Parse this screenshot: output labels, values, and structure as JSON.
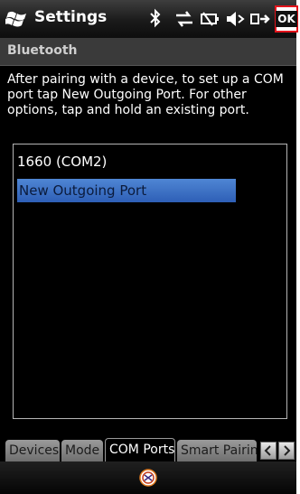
{
  "titlebar": {
    "title": "Settings",
    "ok_label": "OK",
    "icons": [
      "windows-start-icon",
      "bluetooth-icon",
      "sync-icon",
      "battery-icon",
      "volume-icon",
      "network-icon"
    ]
  },
  "section": {
    "title": "Bluetooth"
  },
  "instructions": "After pairing with a device, to set up a COM port tap New Outgoing Port. For other options, tap and hold an existing port.",
  "ports": [
    {
      "label": "1660 (COM2)",
      "selected": false
    },
    {
      "label": "New Outgoing Port",
      "selected": true
    }
  ],
  "tabs": [
    {
      "label": "Devices",
      "active": false
    },
    {
      "label": "Mode",
      "active": false
    },
    {
      "label": "COM Ports",
      "active": true
    },
    {
      "label": "Smart Pairing",
      "active": false
    }
  ],
  "colors": {
    "selection": "#3f74c8",
    "ok_border": "#e3141c",
    "background": "#000000"
  }
}
